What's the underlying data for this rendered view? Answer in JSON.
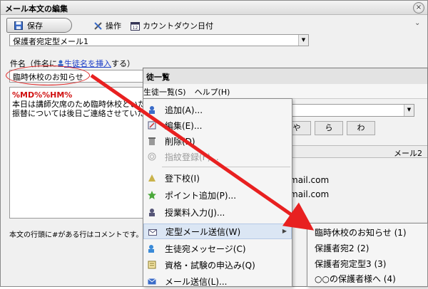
{
  "editor": {
    "title": "メール本文の編集",
    "close_glyph": "×",
    "toolbar": {
      "save_label": "保存",
      "operation_label": "操作",
      "countdown_label": "カウントダウン日付",
      "chevron": "⌄"
    },
    "template_select": {
      "value": "保護者宛定型メール1"
    },
    "subject_label": {
      "prefix": "件名（件名に",
      "link": "生徒名を挿入",
      "suffix": "する）"
    },
    "subject_input": {
      "value": "臨時休校のお知らせ"
    },
    "body": {
      "macro": "%MD%%HM%",
      "line1": "本日は講師欠席のため臨時休校といたしま",
      "line2": "振替については後日ご連絡させていただき"
    },
    "footer_note": "本文の行頭に#がある行はコメントです。送信さ"
  },
  "popup": {
    "title": "徒一覧",
    "menubar": [
      "生徒一覧(S)",
      "ヘルプ(H)"
    ],
    "kana_tabs": [
      "や",
      "ら",
      "わ"
    ],
    "column_header": "メール2",
    "mail_rows": [
      "mail.com",
      "mail.com"
    ]
  },
  "context_menu": {
    "items": [
      {
        "label": "追加(A)...",
        "icon": "add-icon"
      },
      {
        "label": "編集(E)...",
        "icon": "edit-icon"
      },
      {
        "label": "削除(D)",
        "icon": "delete-icon"
      },
      {
        "label": "指紋登録(F)...",
        "icon": "fingerprint-icon",
        "disabled": true
      },
      {
        "label": "登下校(I)",
        "icon": "attendance-icon"
      },
      {
        "label": "ポイント追加(P)...",
        "icon": "point-icon"
      },
      {
        "label": "授業料入力(J)...",
        "icon": "tuition-icon"
      },
      {
        "label": "定型メール送信(W)",
        "icon": "template-mail-icon",
        "highlighted": true
      },
      {
        "label": "生徒宛メッセージ(C)",
        "icon": "message-icon"
      },
      {
        "label": "資格・試験の申込み(Q)",
        "icon": "exam-icon"
      },
      {
        "label": "メール送信(L)...",
        "icon": "mail-send-icon"
      }
    ]
  },
  "submenu": {
    "items": [
      "臨時休校のお知らせ (1)",
      "保護者宛2 (2)",
      "保護者宛定型3 (3)",
      "○○の保護者様へ (4)"
    ]
  },
  "colors": {
    "annotation_red": "#e82020",
    "highlight": "#dbe6f4"
  }
}
